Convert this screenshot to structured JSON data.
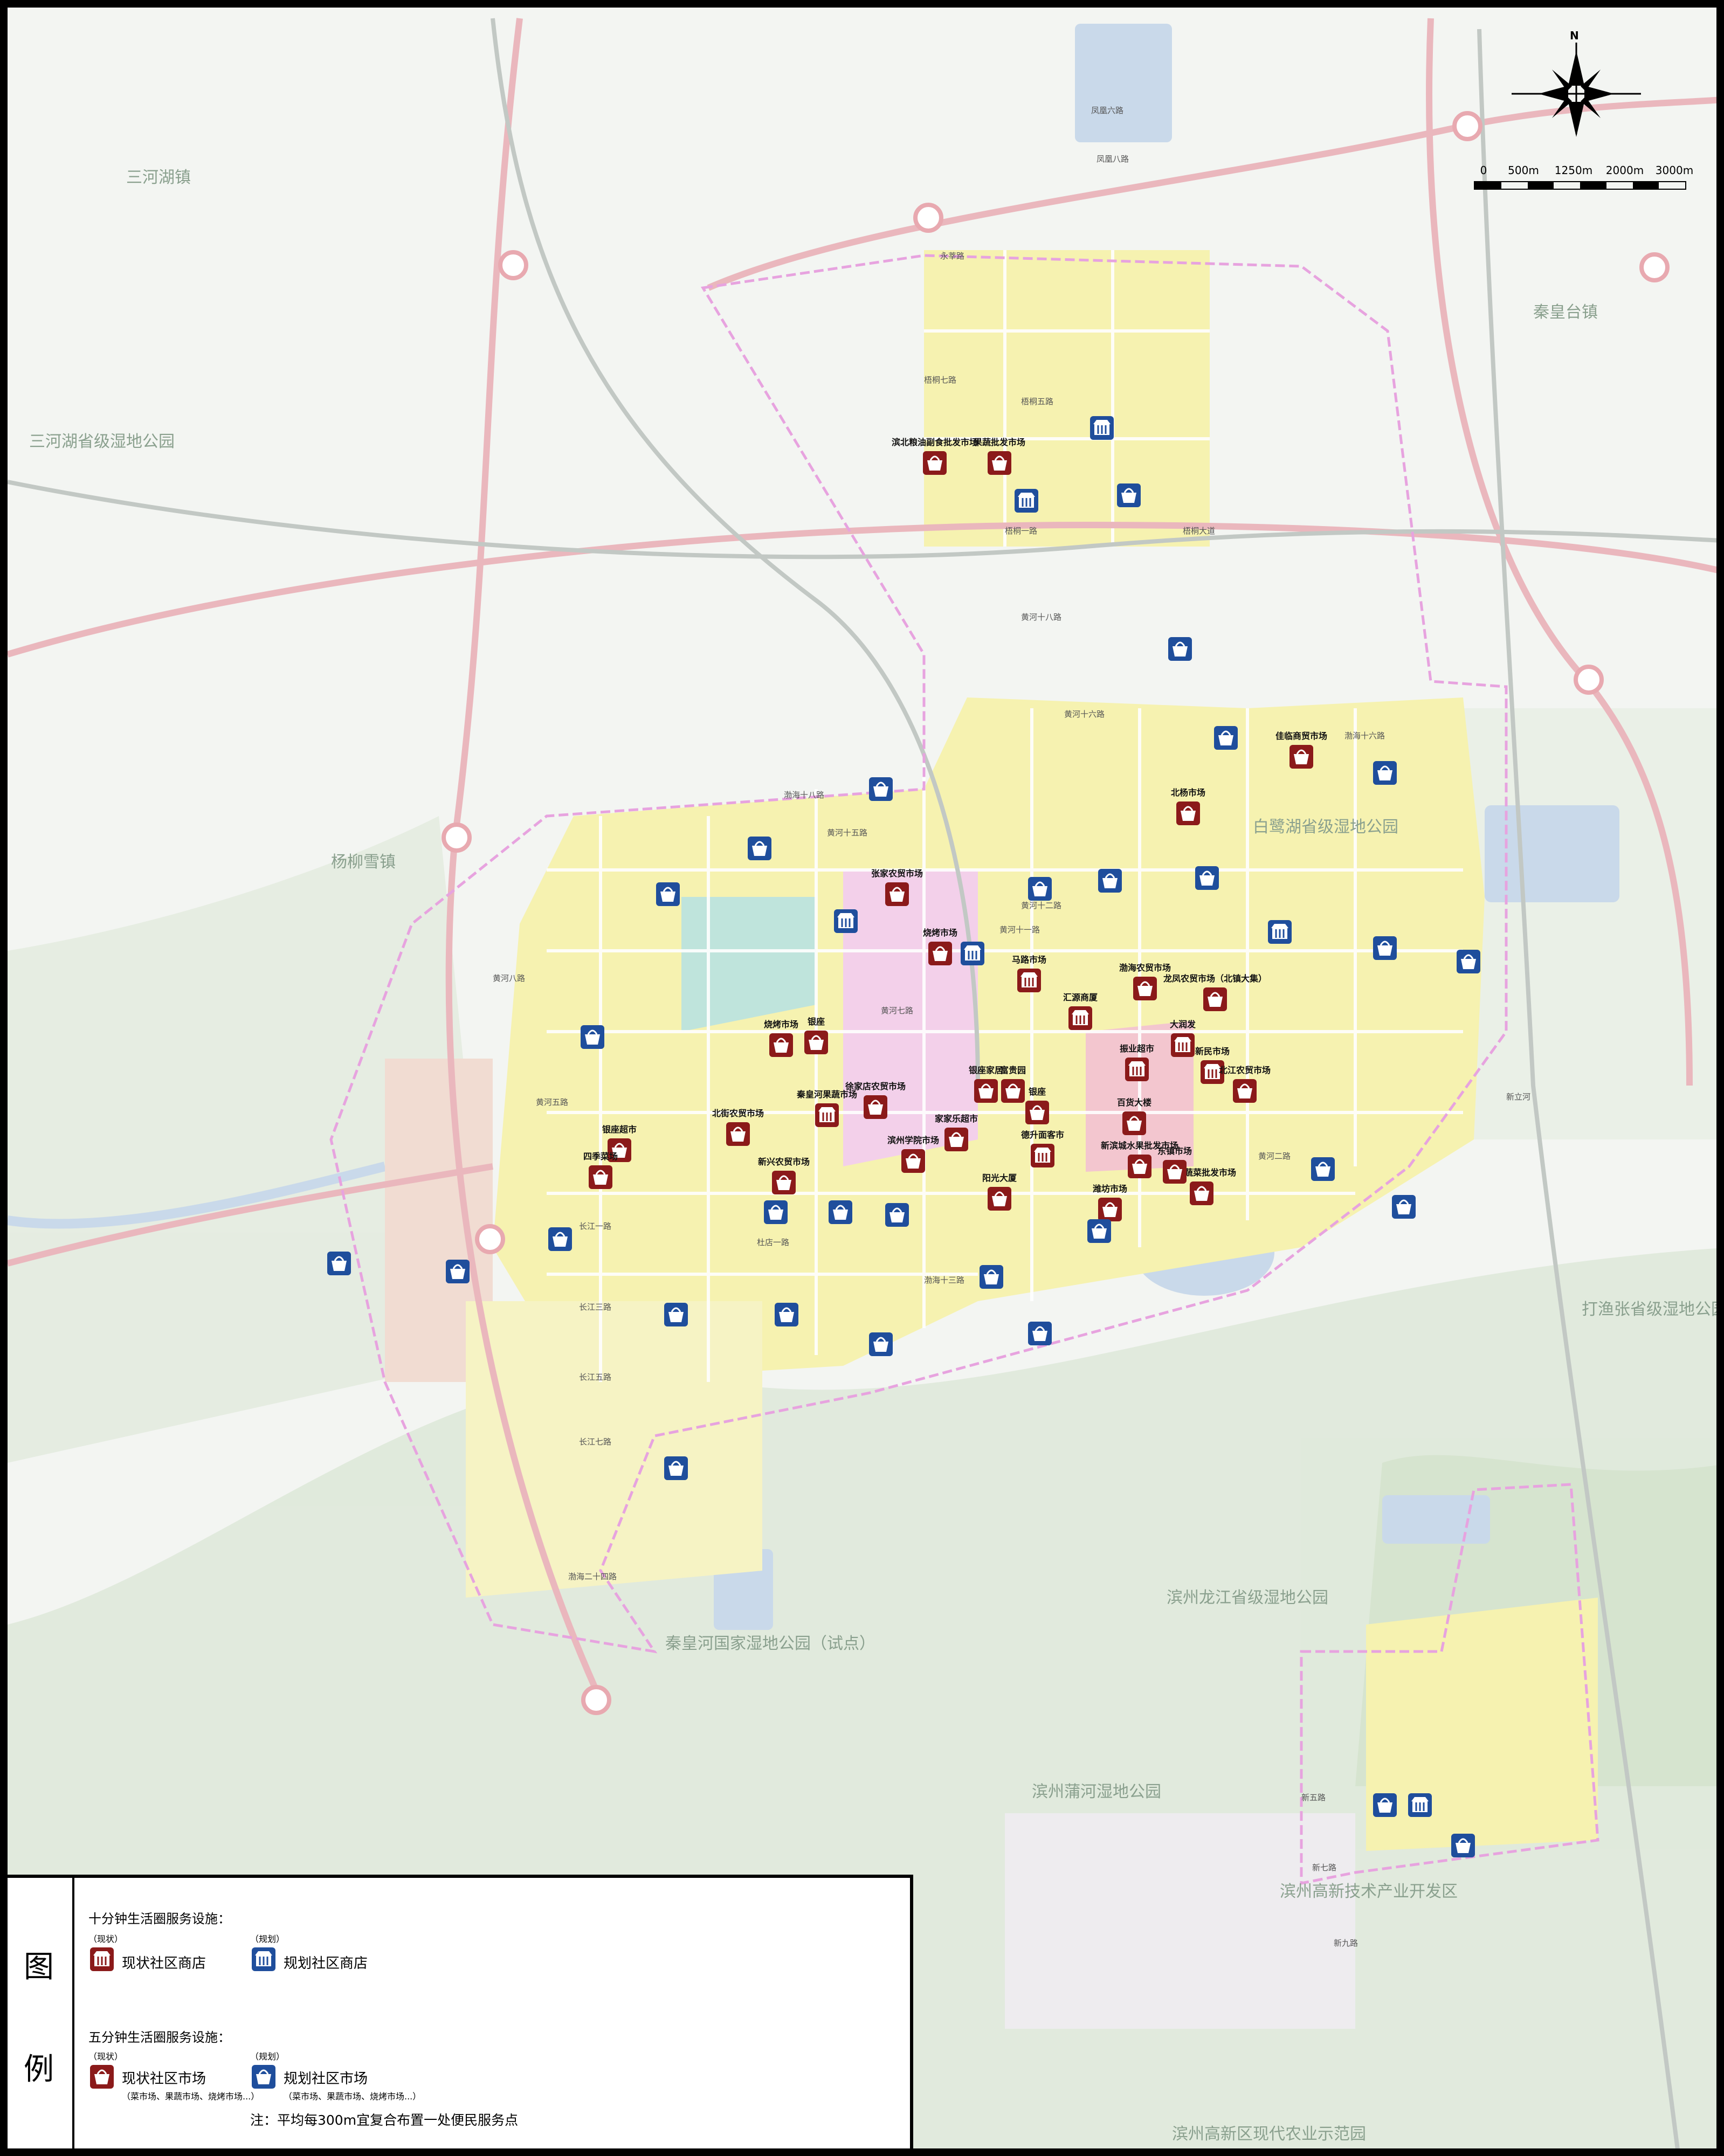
{
  "map": {
    "place_labels": [
      {
        "name": "三河湖镇"
      },
      {
        "name": "三河湖省级湿地公园"
      },
      {
        "name": "秦皇台镇"
      },
      {
        "name": "杨柳雪镇"
      },
      {
        "name": "白鹭湖省级湿地公园"
      },
      {
        "name": "打渔张省级湿地公园"
      },
      {
        "name": "滨州龙江省级湿地公园"
      },
      {
        "name": "秦皇河国家湿地公园（试点）"
      },
      {
        "name": "滨州蒲河湿地公园"
      },
      {
        "name": "滨州高新技术产业开发区"
      },
      {
        "name": "滨州高新区现代农业示范园"
      }
    ],
    "road_labels": [
      "黄河十八路",
      "黄河十六路",
      "黄河十五路",
      "黄河十二路",
      "黄河十一路",
      "黄河八路",
      "黄河七路",
      "黄河五路",
      "黄河二路",
      "长江一路",
      "长江三路",
      "长江五路",
      "长江七路",
      "梧桐七路",
      "梧桐五路",
      "梧桐一路",
      "梧桐大道",
      "新五路",
      "新七路",
      "新九路",
      "永莘路",
      "凤凰八路",
      "凤凰六路",
      "渤海十八路",
      "渤海十六路",
      "渤海十三路",
      "渤海二十四路",
      "新立河",
      "杜店一路"
    ],
    "existing_stores": [
      {
        "name": "滨北粮油副食批发市场"
      },
      {
        "name": "果蔬批发市场"
      },
      {
        "name": "佳临商贸市场"
      },
      {
        "name": "北杨市场"
      },
      {
        "name": "张家农贸市场"
      },
      {
        "name": "烧烤市场"
      },
      {
        "name": "马路市场"
      },
      {
        "name": "汇源商厦"
      },
      {
        "name": "龙凤农贸市场（北镇大集）"
      },
      {
        "name": "渤海农贸市场"
      },
      {
        "name": "烧烤市场"
      },
      {
        "name": "银座"
      },
      {
        "name": "大润发"
      },
      {
        "name": "新民市场"
      },
      {
        "name": "振业超市"
      },
      {
        "name": "银座家居"
      },
      {
        "name": "富贵园"
      },
      {
        "name": "银座"
      },
      {
        "name": "秦皇河果蔬市场"
      },
      {
        "name": "北街农贸市场"
      },
      {
        "name": "银座超市"
      },
      {
        "name": "四季菜场"
      },
      {
        "name": "滨州学院市场"
      },
      {
        "name": "家家乐超市"
      },
      {
        "name": "德升面客市"
      },
      {
        "name": "百货大楼"
      },
      {
        "name": "新滨城水果批发市场"
      },
      {
        "name": "阳光大厦"
      },
      {
        "name": "鲁北蔬菜批发市场"
      },
      {
        "name": "北江农贸市场"
      },
      {
        "name": "东镇市场"
      },
      {
        "name": "潍坊市场"
      },
      {
        "name": "徐家店农贸市场"
      },
      {
        "name": "新兴农贸市场"
      }
    ],
    "planned_stores_count": 6,
    "planned_markets_count": 30,
    "compass": {
      "north_label": "N"
    },
    "scale": {
      "labels": [
        "0",
        "500m",
        "1250m",
        "2000m",
        "3000m"
      ]
    }
  },
  "legend": {
    "title": [
      "图",
      "例"
    ],
    "section1_title": "十分钟生活圈服务设施：",
    "section2_title": "五分钟生活圈服务设施：",
    "status_existing": "（现状）",
    "status_planned": "（规划）",
    "existing_store": "现状社区商店",
    "planned_store": "规划社区商店",
    "existing_market": "现状社区市场",
    "planned_market": "规划社区市场",
    "market_note": "（菜市场、果蔬市场、烧烤市场...）",
    "note": "注：平均每300m宜复合布置一处便民服务点",
    "colors": {
      "existing": "#8b1a1a",
      "planned": "#1f4e9c",
      "road_ring": "#e8a9b0",
      "water": "#c9d9ea",
      "green": "#d8e6d2",
      "residential": "#f5f0a0"
    }
  }
}
